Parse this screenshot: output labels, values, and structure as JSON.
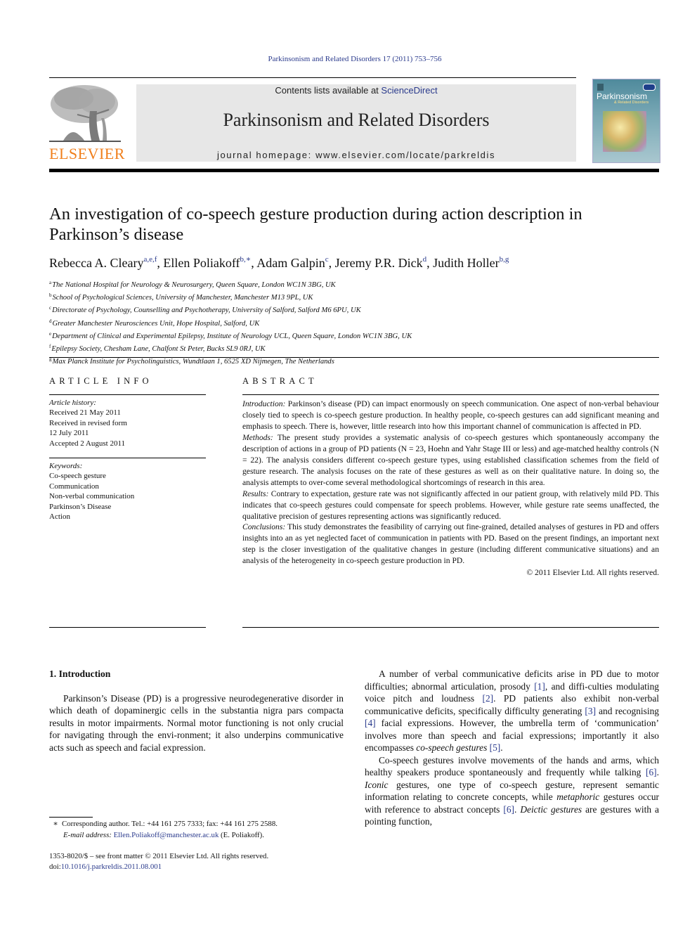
{
  "header": {
    "citation": "Parkinsonism and Related Disorders 17 (2011) 753–756",
    "contents_prefix": "Contents lists available at ",
    "contents_link": "ScienceDirect",
    "journal_title": "Parkinsonism and Related Disorders",
    "homepage_prefix": "journal homepage: ",
    "homepage_url": "www.elsevier.com/locate/parkreldis",
    "publisher": "ELSEVIER",
    "cover_title": "Parkinsonism",
    "cover_subtitle": "& Related Disorders"
  },
  "article": {
    "title": "An investigation of co-speech gesture production during action description in Parkinson’s disease",
    "authors": [
      {
        "name": "Rebecca A. Cleary",
        "sup": "a,e,f"
      },
      {
        "name": "Ellen Poliakoff",
        "sup": "b,∗"
      },
      {
        "name": "Adam Galpin",
        "sup": "c"
      },
      {
        "name": "Jeremy P.R. Dick",
        "sup": "d"
      },
      {
        "name": "Judith Holler",
        "sup": "b,g"
      }
    ],
    "affiliations": [
      {
        "key": "a",
        "text": "The National Hospital for Neurology & Neurosurgery, Queen Square, London WC1N 3BG, UK"
      },
      {
        "key": "b",
        "text": "School of Psychological Sciences, University of Manchester, Manchester M13 9PL, UK"
      },
      {
        "key": "c",
        "text": "Directorate of Psychology, Counselling and Psychotherapy, University of Salford, Salford M6 6PU, UK"
      },
      {
        "key": "d",
        "text": "Greater Manchester Neurosciences Unit, Hope Hospital, Salford, UK"
      },
      {
        "key": "e",
        "text": "Department of Clinical and Experimental Epilepsy, Institute of Neurology UCL, Queen Square, London WC1N 3BG, UK"
      },
      {
        "key": "f",
        "text": "Epilepsy Society, Chesham Lane, Chalfont St Peter, Bucks SL9 0RJ, UK"
      },
      {
        "key": "g",
        "text": "Max Planck Institute for Psycholinguistics, Wundtlaan 1, 6525 XD Nijmegen, The Netherlands"
      }
    ]
  },
  "article_info": {
    "heading": "ARTICLE INFO",
    "history_label": "Article history:",
    "history": [
      "Received 21 May 2011",
      "Received in revised form",
      "12 July 2011",
      "Accepted 2 August 2011"
    ],
    "keywords_label": "Keywords:",
    "keywords": [
      "Co-speech gesture",
      "Communication",
      "Non-verbal communication",
      "Parkinson’s Disease",
      "Action"
    ]
  },
  "abstract": {
    "heading": "ABSTRACT",
    "sections": [
      {
        "label": "Introduction:",
        "text": " Parkinson’s disease (PD) can impact enormously on speech communication. One aspect of non-verbal behaviour closely tied to speech is co-speech gesture production. In healthy people, co-speech gestures can add significant meaning and emphasis to speech. There is, however, little research into how this important channel of communication is affected in PD."
      },
      {
        "label": "Methods:",
        "text": " The present study provides a systematic analysis of co-speech gestures which spontaneously accompany the description of actions in a group of PD patients (N = 23, Hoehn and Yahr Stage III or less) and age-matched healthy controls (N = 22). The analysis considers different co-speech gesture types, using established classification schemes from the field of gesture research. The analysis focuses on the rate of these gestures as well as on their qualitative nature. In doing so, the analysis attempts to over-come several methodological shortcomings of research in this area."
      },
      {
        "label": "Results:",
        "text": " Contrary to expectation, gesture rate was not significantly affected in our patient group, with relatively mild PD. This indicates that co-speech gestures could compensate for speech problems. However, while gesture rate seems unaffected, the qualitative precision of gestures representing actions was significantly reduced."
      },
      {
        "label": "Conclusions:",
        "text": " This study demonstrates the feasibility of carrying out fine-grained, detailed analyses of gestures in PD and offers insights into an as yet neglected facet of communication in patients with PD. Based on the present findings, an important next step is the closer investigation of the qualitative changes in gesture (including different communicative situations) and an analysis of the heterogeneity in co-speech gesture production in PD."
      }
    ],
    "copyright": "© 2011 Elsevier Ltd. All rights reserved."
  },
  "body": {
    "section_heading": "1.  Introduction",
    "left_paragraph": "Parkinson’s Disease (PD) is a progressive neurodegenerative disorder in which death of dopaminergic cells in the substantia nigra pars compacta results in motor impairments. Normal motor functioning is not only crucial for navigating through the envi-ronment; it also underpins communicative acts such as speech and facial expression.",
    "right_p1": [
      {
        "t": "A number of verbal communicative deficits arise in PD due to motor difficulties; abnormal articulation, prosody "
      },
      {
        "ref": "[1]"
      },
      {
        "t": ", and diffi-culties modulating voice pitch and loudness "
      },
      {
        "ref": "[2]"
      },
      {
        "t": ". PD patients also exhibit non-verbal communicative deficits, specifically difficulty generating "
      },
      {
        "ref": "[3]"
      },
      {
        "t": " and recognising "
      },
      {
        "ref": "[4]"
      },
      {
        "t": " facial expressions. However, the umbrella term of ‘communication’ involves more than speech and facial expressions; importantly it also encompasses "
      },
      {
        "i": "co-speech gestures"
      },
      {
        "t": " "
      },
      {
        "ref": "[5]"
      },
      {
        "t": "."
      }
    ],
    "right_p2": [
      {
        "t": "Co-speech gestures involve movements of the hands and arms, which healthy speakers produce spontaneously and frequently while talking "
      },
      {
        "ref": "[6]"
      },
      {
        "t": ". "
      },
      {
        "i": "Iconic"
      },
      {
        "t": " gestures, one type of co-speech gesture, represent semantic information relating to concrete concepts, while "
      },
      {
        "i": "metaphoric"
      },
      {
        "t": " gestures occur with reference to abstract concepts "
      },
      {
        "ref": "[6]"
      },
      {
        "t": ". "
      },
      {
        "i": "Deictic gestures"
      },
      {
        "t": " are gestures with a pointing function,"
      }
    ]
  },
  "footnotes": {
    "marker": "∗",
    "corresponding": "Corresponding author. Tel.: +44 161 275 7333; fax: +44 161 275 2588.",
    "email_label": "E-mail address:",
    "email": "Ellen.Poliakoff@manchester.ac.uk",
    "email_suffix": " (E. Poliakoff).",
    "issn_line": "1353-8020/$ – see front matter © 2011 Elsevier Ltd. All rights reserved.",
    "doi_label": "doi:",
    "doi": "10.1016/j.parkreldis.2011.08.001"
  },
  "colors": {
    "link": "#2a3a8c",
    "elsevier_orange": "#f07f1c",
    "banner_bg": "#e7e7e7"
  }
}
